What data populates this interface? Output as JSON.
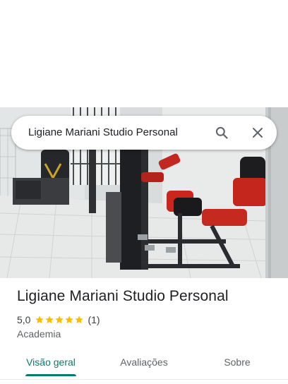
{
  "search": {
    "query": "Ligiane Mariani Studio Personal"
  },
  "place": {
    "name": "Ligiane Mariani Studio Personal",
    "rating": "5,0",
    "stars": 5,
    "review_count": "(1)",
    "category": "Academia"
  },
  "tabs": [
    {
      "label": "Visão geral",
      "active": true
    },
    {
      "label": "Avaliações",
      "active": false
    },
    {
      "label": "Sobre",
      "active": false
    }
  ],
  "icons": {
    "search": "search-icon",
    "close": "close-icon",
    "star": "star-icon"
  },
  "colors": {
    "accent": "#0b7a6e",
    "star": "#fbbc04",
    "text": "#202124",
    "secondary": "#5f6368"
  }
}
